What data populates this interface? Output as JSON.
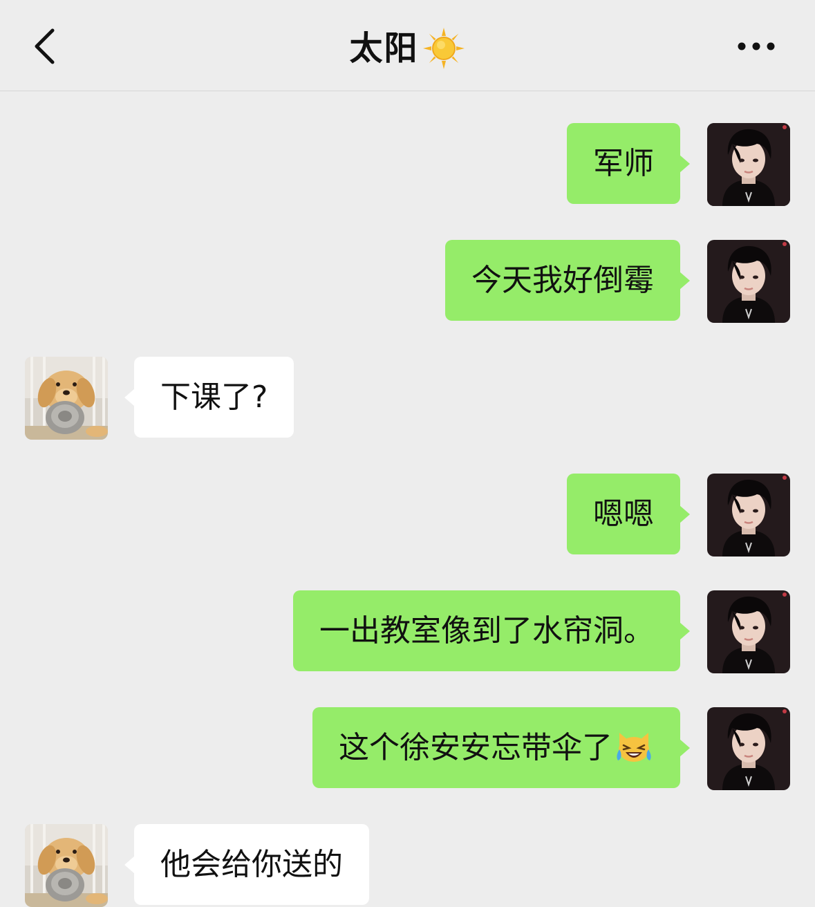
{
  "header": {
    "title": "太阳"
  },
  "messages": [
    {
      "side": "out",
      "text": "军师"
    },
    {
      "side": "out",
      "text": "今天我好倒霉"
    },
    {
      "side": "in",
      "text": "下课了?"
    },
    {
      "side": "out",
      "text": "嗯嗯"
    },
    {
      "side": "out",
      "text": "一出教室像到了水帘洞。"
    },
    {
      "side": "out",
      "text": "这个徐安安忘带伞了",
      "emoji": "crying-laughing-cat-emoji"
    },
    {
      "side": "in",
      "text": "他会给你送的"
    }
  ],
  "colors": {
    "background": "#ededed",
    "outgoing_bubble": "#95ec69",
    "incoming_bubble": "#ffffff"
  }
}
